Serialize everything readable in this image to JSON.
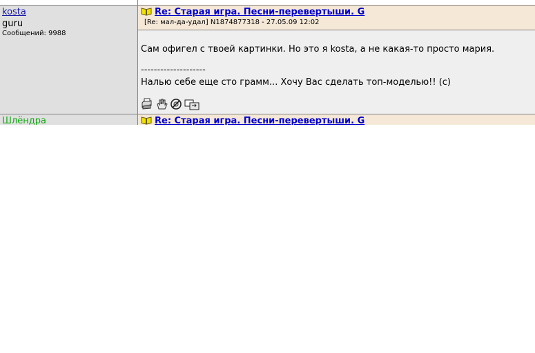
{
  "posts": [
    {
      "username": "kosta",
      "title": "guru",
      "count": "Сообщений: 9988",
      "subject": "Re: Старая игра. Песни-перевертыши. G",
      "meta": "[Re: мал-да-удал]  N1874877318 - 27.05.09 12:02",
      "body": [
        "Сам офигел с твоей картинки. Но это я kosta, а не какая-то просто мария.",
        "--------------------",
        "Налью себе еще сто грамм... Хочу Вас сделать топ-моделью!! (с)"
      ]
    },
    {
      "username": "Шлёндра",
      "subject": "Re: Старая игра. Песни-перевертыши. G"
    }
  ],
  "colors": {
    "header_bg": "#f5e8d7",
    "body_bg": "#efefef",
    "author_bg": "#e0e0e0",
    "link": "#0000cc",
    "user_link": "#1a1aa6",
    "user_green": "#13a913"
  },
  "icons": {
    "post": "book-icon",
    "tools": [
      "print-icon",
      "hand-icon",
      "ignore-icon",
      "forward-icon"
    ]
  }
}
